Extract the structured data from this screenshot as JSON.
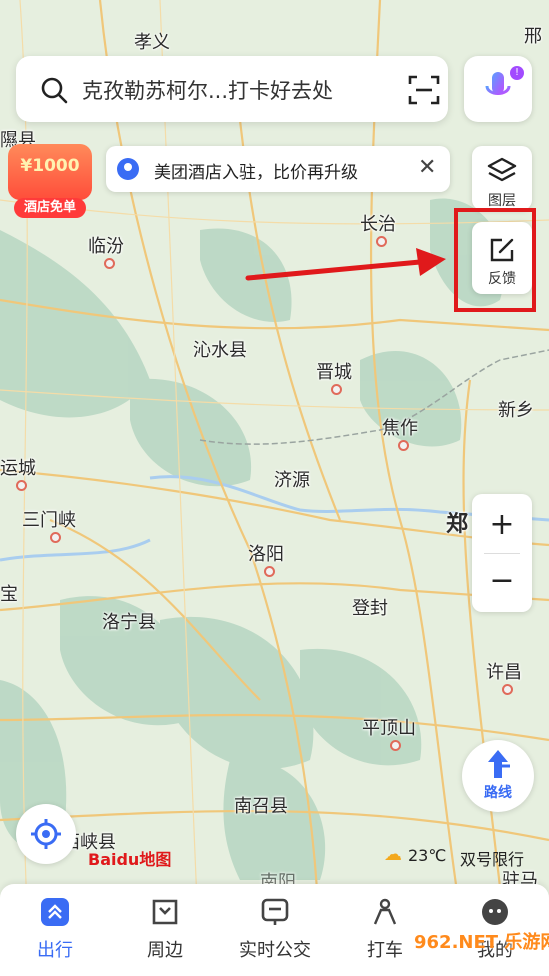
{
  "search": {
    "placeholder_text": "克孜勒苏柯尔...打卡好去处"
  },
  "promo_badge": {
    "amount": "¥1000",
    "label": "酒店免单"
  },
  "notice": {
    "text": "美团酒店入驻，比价再升级"
  },
  "controls": {
    "layers_label": "图层",
    "feedback_label": "反馈",
    "zoom_in": "+",
    "zoom_out": "−",
    "route_label": "路线"
  },
  "map_labels": {
    "xiaoyi": "孝义",
    "xing": "邢",
    "xi_edge": "隰县",
    "linfen": "临汾",
    "changzhi": "长治",
    "qinshui": "沁水县",
    "jincheng": "晋城",
    "xinxiang": "新乡",
    "jiaozuo": "焦作",
    "yuncheng": "运城",
    "jiyuan": "济源",
    "sanmenxia": "三门峡",
    "zheng": "郑",
    "luoyang": "洛阳",
    "bao": "宝",
    "dengfeng": "登封",
    "luoning": "洛宁县",
    "xuchang": "许昌",
    "pingdingshan": "平顶山",
    "nanzhao": "南召县",
    "xixia": "西峡县",
    "nanyang": "南阳",
    "zhuma": "驻马"
  },
  "weather": {
    "temp": "23℃",
    "restriction": "双号限行"
  },
  "logo": {
    "text": "Baidu地图"
  },
  "bottom_nav": [
    {
      "label": "出行",
      "active": true
    },
    {
      "label": "周边",
      "active": false
    },
    {
      "label": "实时公交",
      "active": false
    },
    {
      "label": "打车",
      "active": false
    },
    {
      "label": "我的",
      "active": false
    }
  ],
  "watermark": "962.NET 乐游网",
  "colors": {
    "accent": "#3a6cf4",
    "annotation_red": "#e0191b",
    "road": "#f0c77a"
  }
}
